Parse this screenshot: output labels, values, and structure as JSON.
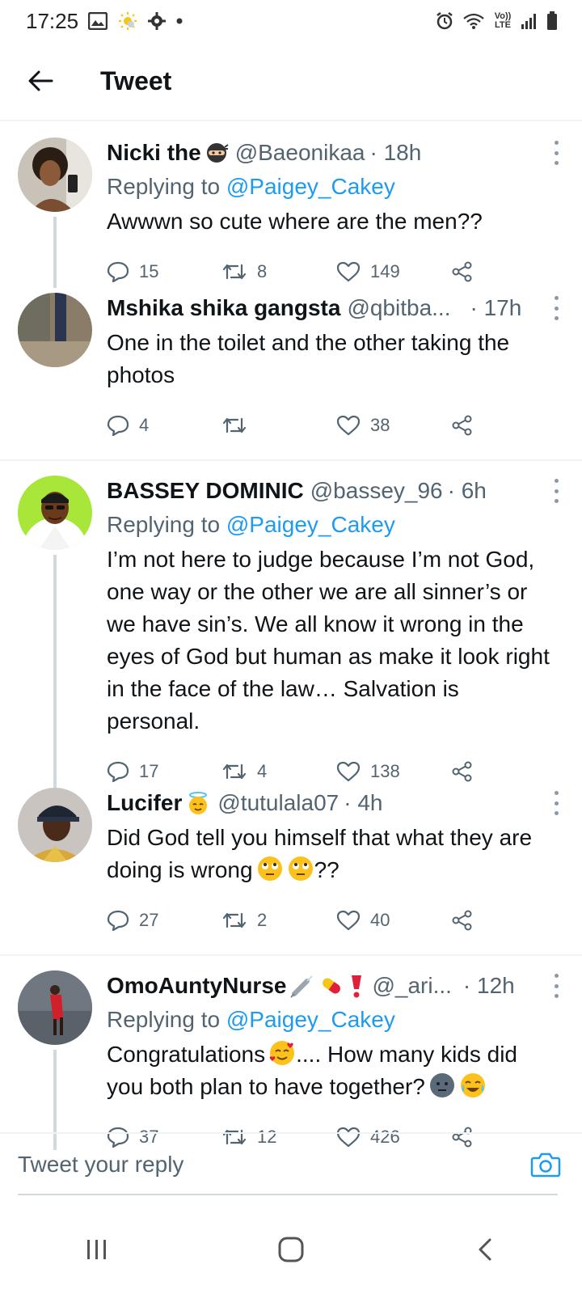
{
  "status_bar": {
    "time": "17:25",
    "network": "Vo)) LTE"
  },
  "header": {
    "title": "Tweet"
  },
  "tweets": [
    {
      "name": "Nicki the",
      "name_emoji": "ninja",
      "handle": "@Baeonikaa",
      "time": "· 18h",
      "reply_prefix": "Replying to",
      "reply_to": "@Paigey_Cakey",
      "text": "Awwwn so cute where are the men??",
      "replies": "15",
      "retweets": "8",
      "likes": "149"
    },
    {
      "name": "Mshika shika gangsta",
      "handle": "@qbitba...",
      "time": "· 17h",
      "text": "One in the toilet and the other taking the photos",
      "replies": "4",
      "retweets": "",
      "likes": "38"
    },
    {
      "name": "BASSEY DOMINIC",
      "handle": "@bassey_96",
      "time": "· 6h",
      "reply_prefix": "Replying to",
      "reply_to": "@Paigey_Cakey",
      "text": "I’m not here to judge because I’m not God, one way or the other we are all sinner’s or we  have sin’s. We all know it wrong in the eyes of God but human as make it look right in the face of the law… Salvation is personal.",
      "replies": "17",
      "retweets": "4",
      "likes": "138"
    },
    {
      "name": "Lucifer",
      "name_emoji": "angel-face",
      "handle": "@tutulala07",
      "time": "· 4h",
      "text": "Did God tell you himself that what they are doing is wrong",
      "text_suffix": "??",
      "replies": "27",
      "retweets": "2",
      "likes": "40"
    },
    {
      "name": "OmoAuntyNurse",
      "name_emoji": "syringe-pill-exclamation",
      "handle": "@_ari...",
      "time": "· 12h",
      "reply_prefix": "Replying to",
      "reply_to": "@Paigey_Cakey",
      "text_a": "Congratulations",
      "text_b": ".... How many kids did you both plan to have together?",
      "replies": "37",
      "retweets": "12",
      "likes": "426"
    }
  ],
  "reply_bar": {
    "placeholder": "Tweet your reply"
  },
  "colors": {
    "accent": "#1d9bf0",
    "secondary_text": "#536471",
    "divider": "#eff3f4"
  }
}
